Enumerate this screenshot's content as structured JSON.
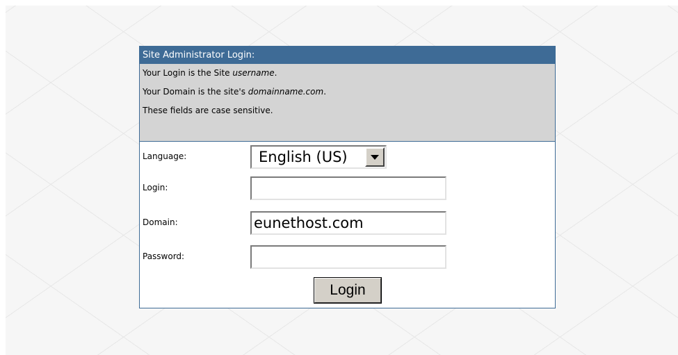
{
  "panel": {
    "title": "Site Administrator Login:"
  },
  "info": {
    "line1_prefix": "Your Login is the Site ",
    "line1_em": "username",
    "line1_suffix": ".",
    "line2_prefix": "Your Domain is the site's ",
    "line2_em": "domainname.com",
    "line2_suffix": ".",
    "line3": "These fields are case sensitive."
  },
  "form": {
    "language": {
      "label": "Language:",
      "value": "English (US)"
    },
    "login": {
      "label": "Login:",
      "value": ""
    },
    "domain": {
      "label": "Domain:",
      "value": "eunethost.com"
    },
    "password": {
      "label": "Password:",
      "value": ""
    },
    "submit_label": "Login"
  },
  "icons": {
    "dropdown": "chevron-down-icon"
  },
  "colors": {
    "header_bg": "#3e6b96",
    "info_bg": "#d4d4d4",
    "button_bg": "#d4d0c8"
  }
}
